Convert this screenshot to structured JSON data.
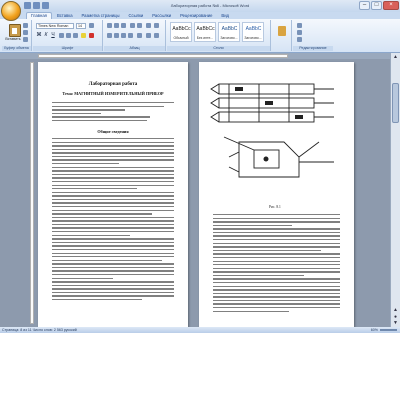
{
  "window": {
    "title": "Лабораторная работа №8 - Microsoft Word"
  },
  "tabs": [
    {
      "label": "Главная",
      "active": true
    },
    {
      "label": "Вставка",
      "active": false
    },
    {
      "label": "Разметка страницы",
      "active": false
    },
    {
      "label": "Ссылки",
      "active": false
    },
    {
      "label": "Рассылки",
      "active": false
    },
    {
      "label": "Рецензирование",
      "active": false
    },
    {
      "label": "Вид",
      "active": false
    }
  ],
  "ribbon": {
    "paste_label": "Вставить",
    "clipboard_label": "Буфер обмена",
    "font_name": "Times New Roman",
    "font_size": "14",
    "font_group_label": "Шрифт",
    "paragraph_group_label": "Абзац",
    "styles_group_label": "Стили",
    "editing_group_label": "Редактирование",
    "bold": "Ж",
    "italic": "К",
    "underline": "Ч",
    "styles": [
      {
        "sample": "AaBbCc",
        "name": "Обычный"
      },
      {
        "sample": "AaBbCc",
        "name": "Без инте..."
      },
      {
        "sample": "AaBbC",
        "name": "Заголово..."
      },
      {
        "sample": "AaBbC",
        "name": "Заголово..."
      }
    ]
  },
  "document": {
    "left_page": {
      "heading": "Лабораторная работа",
      "subheading": "Тема: МАГНИТНЫЙ ИЗМЕРИТЕЛЬНЫЙ ПРИБОР",
      "section_title": "Общие сведения"
    },
    "right_page": {
      "figure_caption": "Рис. 8.1"
    }
  },
  "status": {
    "text": "Страница: 8 из 11   Число слов: 2 563   русский",
    "zoom": "60%"
  }
}
